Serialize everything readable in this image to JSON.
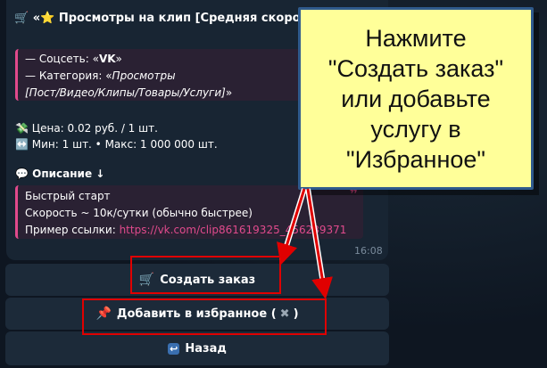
{
  "message": {
    "header_prefix": "🛒 «",
    "header_star": "⭐",
    "header_title": " Просмотры на клип [Средняя скорость]»",
    "info_quote": {
      "social_label": "— Соцсеть: «",
      "social_value": "VK",
      "social_end": "»",
      "category_label": "— Категория: «",
      "category_value_line1": "Просмотры",
      "category_value_line2": "[Пост/Видео/Клипы/Товары/Услуги]",
      "category_end": "»"
    },
    "price": "Цена: 0.02 руб. / 1 шт.",
    "minmax": "Мин: 1 шт. • Макс: 1 000 000 шт.",
    "description_title": "Описание ↓",
    "description_quote": {
      "line1": "Быстрый старт",
      "line2": "Скорость ~ 10к/сутки (обычно быстрее)",
      "example_label": "Пример ссылки: ",
      "example_link": "https://vk.com/clip861619325_456239371"
    },
    "time": "16:08"
  },
  "buttons": {
    "create_order": "Создать заказ",
    "add_favorite": "Добавить в избранное (",
    "add_favorite_end": ")",
    "back": "Назад"
  },
  "callout": {
    "line1": "Нажмите",
    "line2": "\"Создать заказ\"",
    "line3": "или добавьте",
    "line4": "услугу в",
    "line5": "\"Избранное\""
  },
  "icons": {
    "cart": "shopping-cart-icon",
    "star": "star-icon",
    "pushpin": "pushpin-icon",
    "close": "close-icon",
    "back": "back-arrow-icon",
    "money": "money-icon",
    "minmax": "left-right-arrow-icon",
    "speech": "speech-bubble-icon"
  },
  "colors": {
    "accent": "#e04a8c",
    "highlight": "#e00000",
    "callout_bg": "#ffff99",
    "callout_border": "#2f5a8c"
  }
}
